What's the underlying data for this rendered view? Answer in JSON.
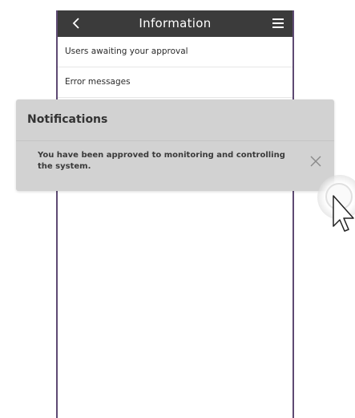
{
  "header": {
    "title": "Information",
    "back_icon": "chevron-left-icon",
    "menu_icon": "hamburger-menu-icon"
  },
  "list": {
    "items": [
      {
        "label": "Users awaiting your approval"
      },
      {
        "label": "Error messages"
      }
    ]
  },
  "notifications": {
    "title": "Notifications",
    "message": "You have been approved to monitoring and controlling the system.",
    "close_icon": "close-icon"
  },
  "colors": {
    "topbar": "#3b3b3b",
    "frame_border": "#5e4a73",
    "overlay": "#d2d2d2",
    "text": "#333333"
  }
}
